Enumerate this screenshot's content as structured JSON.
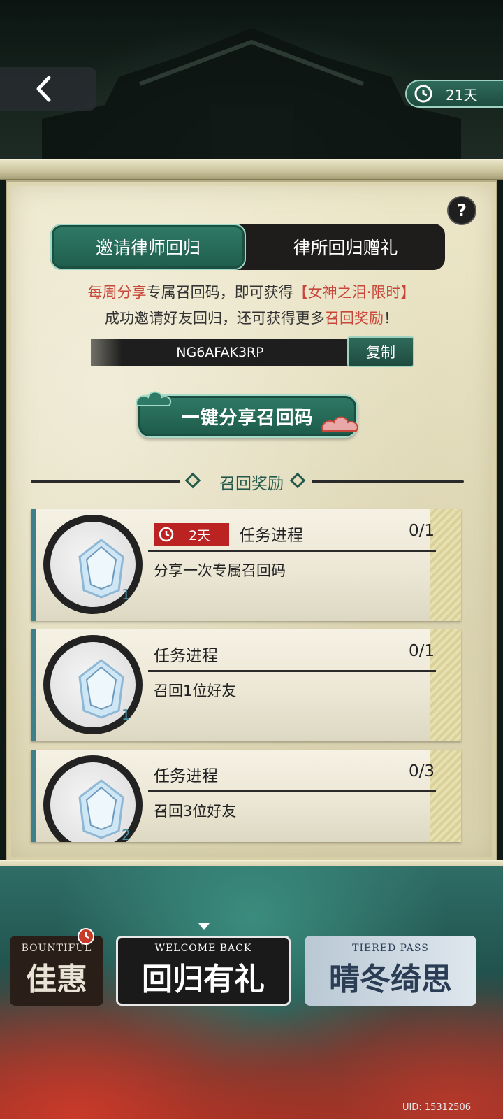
{
  "header": {
    "timer_label": "21天"
  },
  "tabs": [
    {
      "label": "邀请律师回归",
      "active": true
    },
    {
      "label": "律所回归赠礼",
      "active": false
    }
  ],
  "description": {
    "line1_part1": "每周分享",
    "line1_part2": "专属召回码，即可获得",
    "line1_part3": "【女神之泪·限时】",
    "line2_part1": "成功邀请好友回归，还可获得更多",
    "line2_part2": "召回奖励",
    "line2_part3": "！"
  },
  "recall_code": {
    "value": "NG6AFAK3RP",
    "copy_label": "复制"
  },
  "share_button_label": "一键分享召回码",
  "section_title": "召回奖励",
  "tasks": [
    {
      "time_tag": "2天",
      "title": "任务进程",
      "progress": "0/1",
      "description": "分享一次专属召回码",
      "reward_count": "1"
    },
    {
      "title": "任务进程",
      "progress": "0/1",
      "description": "召回1位好友",
      "reward_count": "1"
    },
    {
      "title": "任务进程",
      "progress": "0/3",
      "description": "召回3位好友",
      "reward_count": "2"
    }
  ],
  "banners": [
    {
      "small": "BOUNTIFUL",
      "big": "佳惠"
    },
    {
      "small": "WELCOME BACK",
      "big": "回归有礼"
    },
    {
      "small": "TIERED PASS",
      "big": "晴冬绮思"
    }
  ],
  "uid": "UID: 15312506",
  "colors": {
    "accent_green": "#2f7a66",
    "highlight_red": "#c9473a",
    "time_tag_red": "#bb2323",
    "parchment": "#e5dfbf"
  },
  "icons": [
    "back-arrow-icon",
    "clock-icon",
    "help-icon",
    "cloud-ornament-icon",
    "diamond-icon",
    "gem-icon"
  ]
}
